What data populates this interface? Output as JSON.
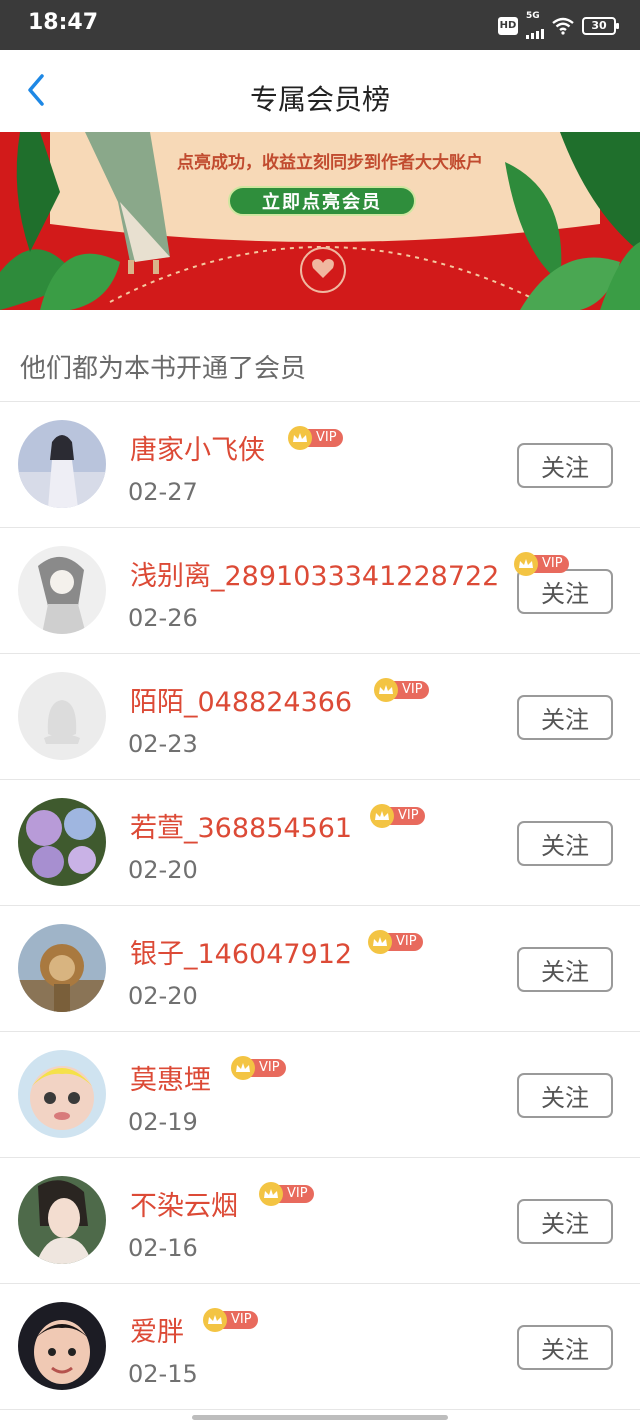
{
  "status": {
    "time": "18:47",
    "hd": "HD",
    "network": "5G",
    "battery": "30"
  },
  "nav": {
    "title": "专属会员榜"
  },
  "banner": {
    "text": "点亮成功，收益立刻同步到作者大大账户",
    "cta": "立即点亮会员"
  },
  "section": {
    "title": "他们都为本书开通了会员"
  },
  "vip_label": "VIP",
  "colors": {
    "name": "#dc4a36",
    "banner_red": "#d21a1a",
    "cta_green": "#2f8e3c",
    "vip_tag": "#e86a5d",
    "crown": "#f3c443"
  },
  "members": [
    {
      "name": "唐家小飞侠",
      "date": "02-27",
      "follow": "关注"
    },
    {
      "name": "浅别离_2891033341228722",
      "date": "02-26",
      "follow": "关注"
    },
    {
      "name": "陌陌_048824366",
      "date": "02-23",
      "follow": "关注"
    },
    {
      "name": "若萱_368854561",
      "date": "02-20",
      "follow": "关注"
    },
    {
      "name": "银子_146047912",
      "date": "02-20",
      "follow": "关注"
    },
    {
      "name": "莫惠堙",
      "date": "02-19",
      "follow": "关注"
    },
    {
      "name": "不染云烟",
      "date": "02-16",
      "follow": "关注"
    },
    {
      "name": "爱胖",
      "date": "02-15",
      "follow": "关注"
    }
  ]
}
